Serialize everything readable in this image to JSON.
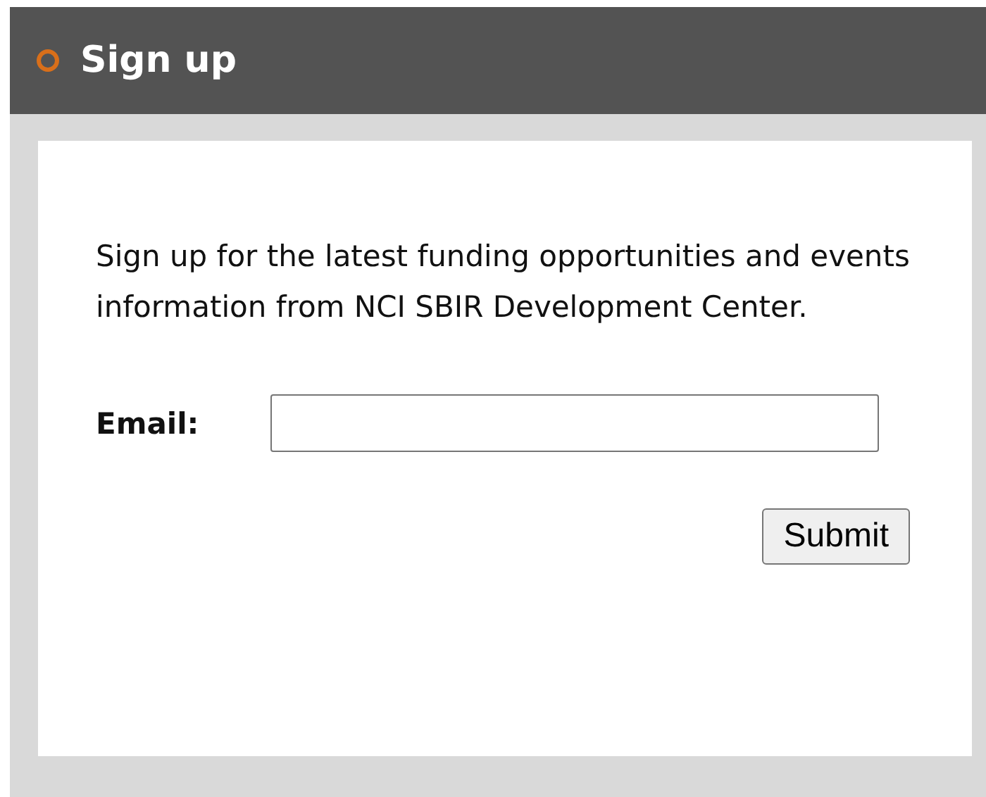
{
  "header": {
    "title": "Sign up"
  },
  "intro": "Sign up for the latest funding opportunities and events information from NCI SBIR Development Center.",
  "email": {
    "label": "Email:"
  },
  "buttons": [
    "Submit"
  ]
}
